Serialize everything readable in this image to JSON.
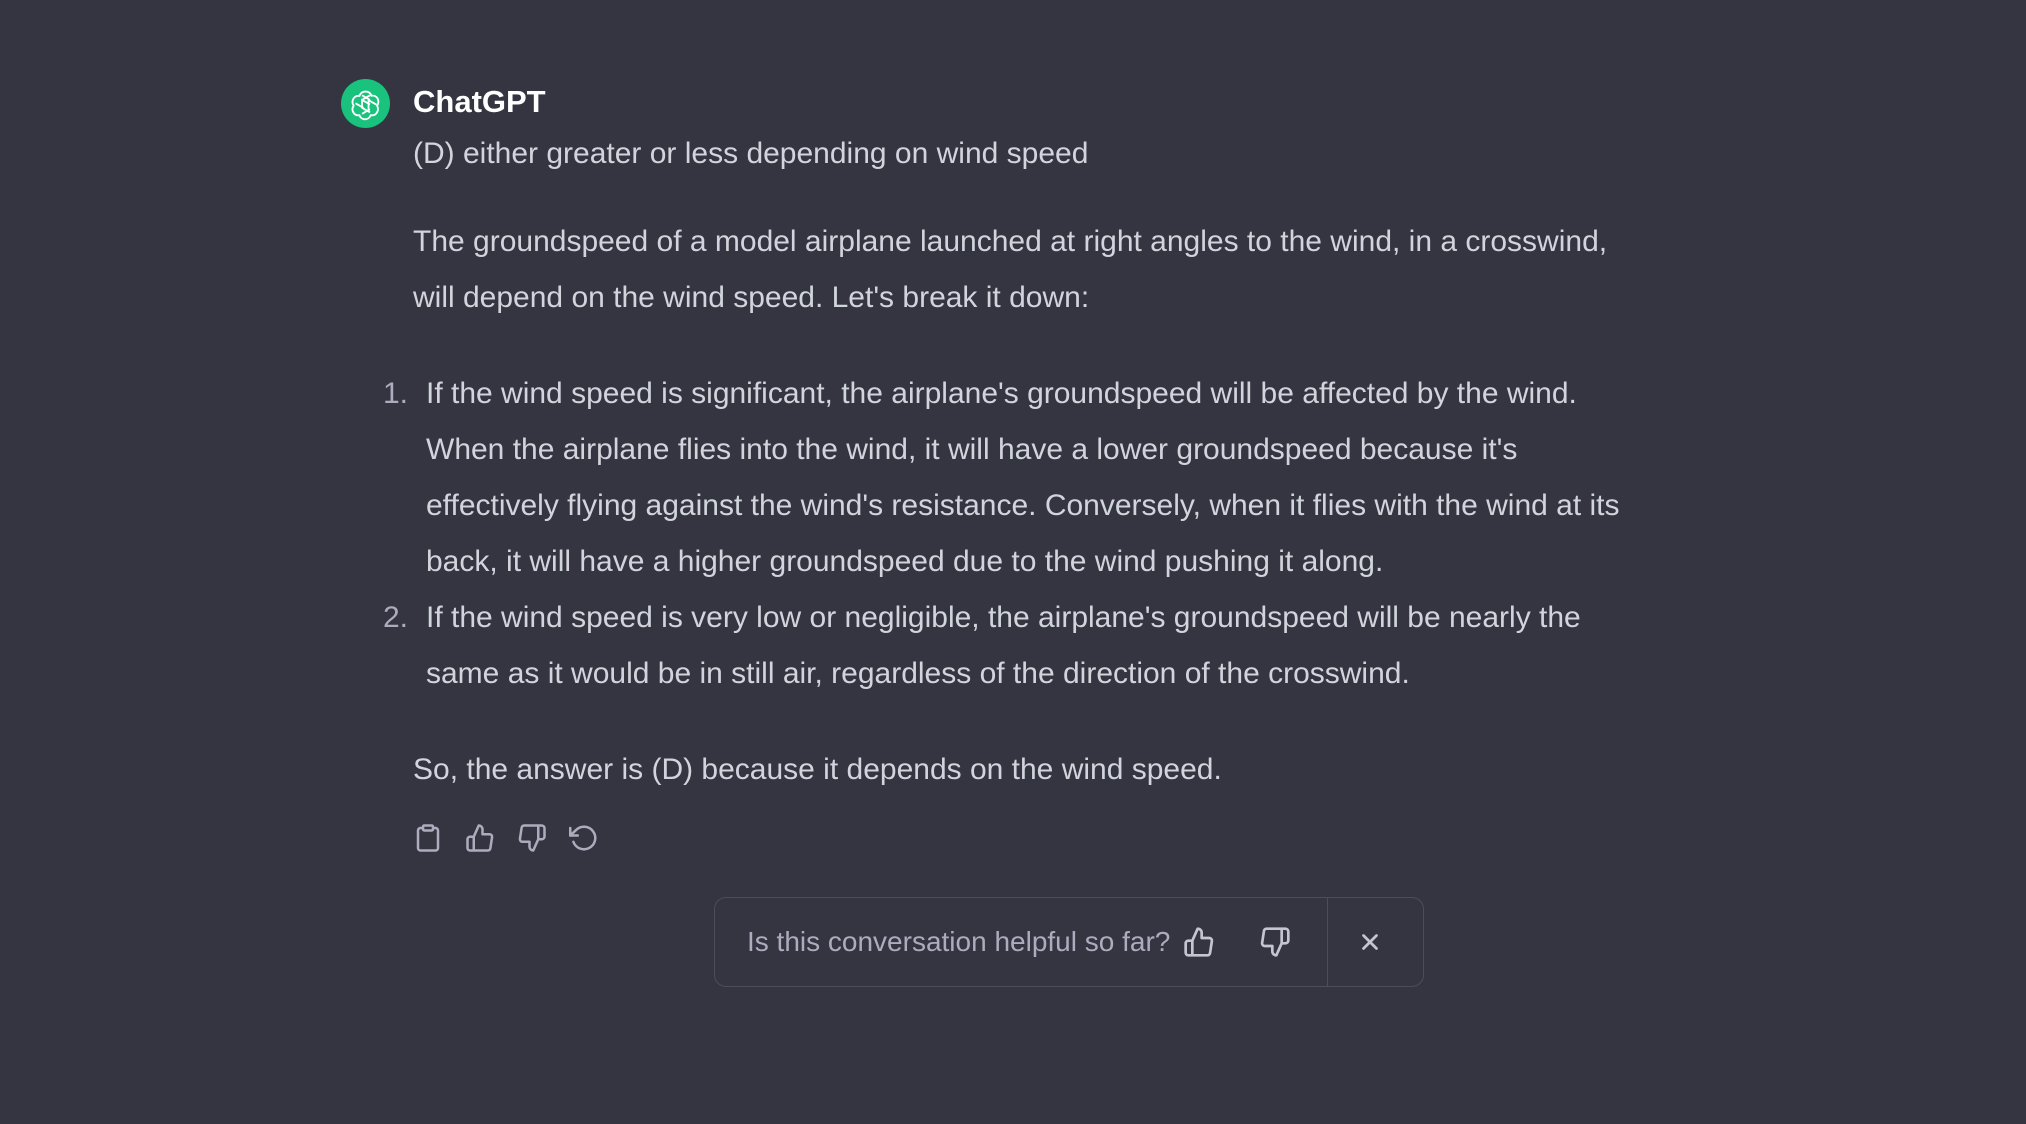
{
  "colors": {
    "background": "#343541",
    "avatar": "#19c37d",
    "text": "#d1d5db",
    "muted": "#acacbe"
  },
  "message": {
    "author": "ChatGPT",
    "avatar_icon": "openai-logo-icon",
    "first_line": "(D) either greater or less depending on wind speed",
    "intro": "The groundspeed of a model airplane launched at right angles to the wind, in a crosswind, will depend on the wind speed. Let's break it down:",
    "list": [
      {
        "number": "1.",
        "text": "If the wind speed is significant, the airplane's groundspeed will be affected by the wind. When the airplane flies into the wind, it will have a lower groundspeed because it's effectively flying against the wind's resistance. Conversely, when it flies with the wind at its back, it will have a higher groundspeed due to the wind pushing it along."
      },
      {
        "number": "2.",
        "text": "If the wind speed is very low or negligible, the airplane's groundspeed will be nearly the same as it would be in still air, regardless of the direction of the crosswind."
      }
    ],
    "conclusion": "So, the answer is (D) because it depends on the wind speed."
  },
  "actions": [
    {
      "name": "copy-button",
      "icon": "clipboard-icon"
    },
    {
      "name": "thumbs-up-button",
      "icon": "thumbs-up-icon"
    },
    {
      "name": "thumbs-down-button",
      "icon": "thumbs-down-icon"
    },
    {
      "name": "regenerate-button",
      "icon": "refresh-icon"
    }
  ],
  "feedback": {
    "prompt": "Is this conversation helpful so far?",
    "up_icon": "thumbs-up-icon",
    "down_icon": "thumbs-down-icon",
    "close_icon": "close-icon"
  }
}
